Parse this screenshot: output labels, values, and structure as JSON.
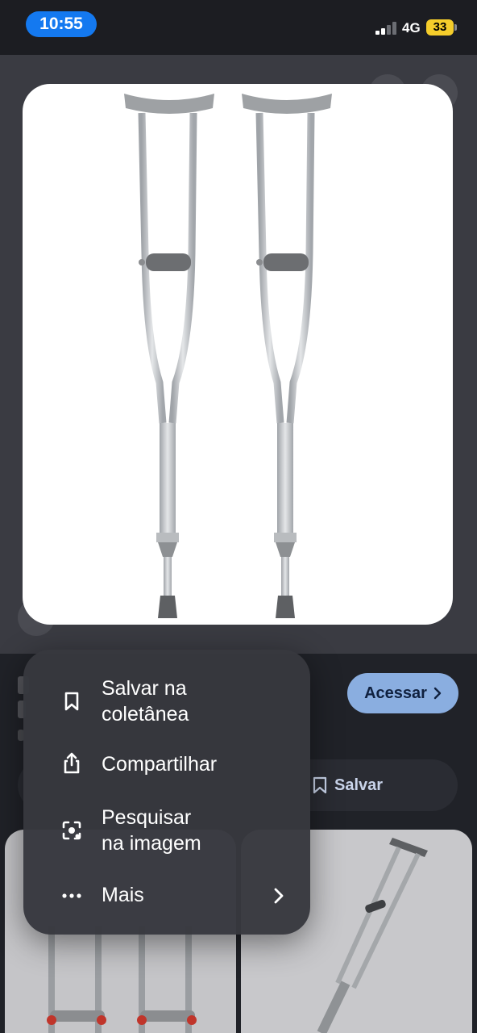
{
  "status_bar": {
    "time": "10:55",
    "network": "4G",
    "battery": "33"
  },
  "context_menu": {
    "items": [
      {
        "label": "Salvar na\ncoletânea",
        "icon": "bookmark-icon"
      },
      {
        "label": "Compartilhar",
        "icon": "share-icon"
      },
      {
        "label": "Pesquisar\nna imagem",
        "icon": "lens-search-icon"
      },
      {
        "label": "Mais",
        "icon": "more-dots-icon"
      }
    ]
  },
  "result": {
    "visit_label": "Acessar",
    "save_label": "Salvar"
  },
  "colors": {
    "time_pill": "#1479f0",
    "visit_button": "#8aaee0",
    "menu_bg": "#37383e"
  }
}
